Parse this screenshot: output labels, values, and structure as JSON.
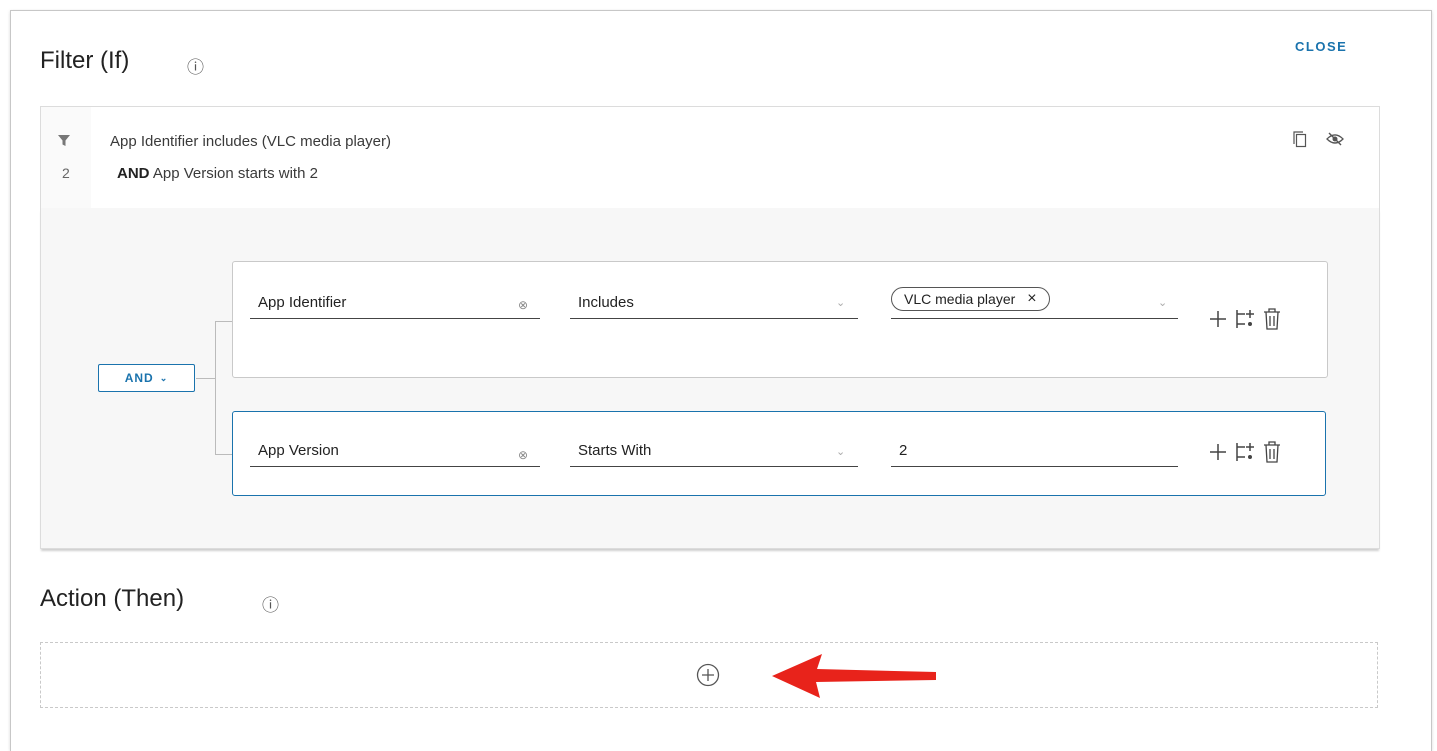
{
  "filter": {
    "title": "Filter (If)",
    "info_icon": "ⓘ",
    "close_label": "CLOSE",
    "summary": {
      "count": "2",
      "line1": "App Identifier includes (VLC media player)",
      "line2_operator": "AND",
      "line2_text": "App Version starts with 2"
    },
    "group_operator": "AND",
    "rules": [
      {
        "attribute": "App Identifier",
        "operator": "Includes",
        "value_chip": "VLC media player"
      },
      {
        "attribute": "App Version",
        "operator": "Starts With",
        "value": "2"
      }
    ]
  },
  "action": {
    "title": "Action (Then)",
    "info_icon": "ⓘ"
  },
  "colors": {
    "accent": "#1a73ad",
    "arrow": "#e8231b",
    "border": "#c9c9c9"
  },
  "icons": [
    "filter-icon",
    "copy-icon",
    "hide-eye-icon",
    "clear-icon",
    "chevron-down-icon",
    "plus-icon",
    "add-subgroup-icon",
    "trash-icon",
    "add-circle-icon",
    "red-arrow-annotation"
  ]
}
